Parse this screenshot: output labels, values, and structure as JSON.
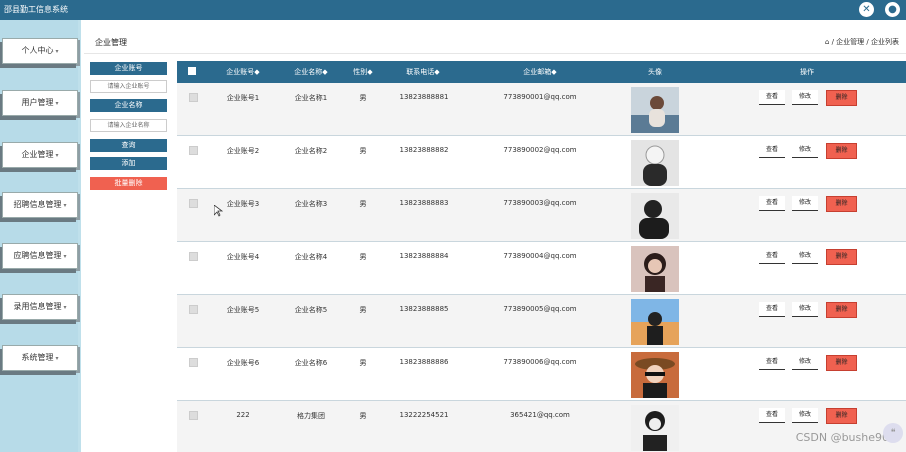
{
  "app": {
    "title": "邵县勤工信息系统"
  },
  "sidebar": {
    "items": [
      {
        "label": "个人中心"
      },
      {
        "label": "用户管理"
      },
      {
        "label": "企业管理"
      },
      {
        "label": "招聘信息管理"
      },
      {
        "label": "应聘信息管理"
      },
      {
        "label": "录用信息管理"
      },
      {
        "label": "系统管理"
      }
    ]
  },
  "page": {
    "title": "企业管理",
    "breadcrumb": "/ 企业管理 / 企业列表"
  },
  "search": {
    "account_label": "企业账号",
    "account_placeholder": "请输入企业账号",
    "name_label": "企业名称",
    "name_placeholder": "请输入企业名称",
    "query_label": "查询",
    "add_label": "添加",
    "batch_delete_label": "批量删除"
  },
  "table": {
    "headers": {
      "account": "企业账号◆",
      "name": "企业名称◆",
      "gender": "性别◆",
      "phone": "联系电话◆",
      "email": "企业邮箱◆",
      "avatar": "头像",
      "actions": "操作"
    },
    "view_label": "查看",
    "edit_label": "修改",
    "delete_label": "删除",
    "rows": [
      {
        "account": "企业账号1",
        "name": "企业名称1",
        "gender": "男",
        "phone": "13823888881",
        "email": "773890001@qq.com"
      },
      {
        "account": "企业账号2",
        "name": "企业名称2",
        "gender": "男",
        "phone": "13823888882",
        "email": "773890002@qq.com"
      },
      {
        "account": "企业账号3",
        "name": "企业名称3",
        "gender": "男",
        "phone": "13823888883",
        "email": "773890003@qq.com"
      },
      {
        "account": "企业账号4",
        "name": "企业名称4",
        "gender": "男",
        "phone": "13823888884",
        "email": "773890004@qq.com"
      },
      {
        "account": "企业账号5",
        "name": "企业名称5",
        "gender": "男",
        "phone": "13823888885",
        "email": "773890005@qq.com"
      },
      {
        "account": "企业账号6",
        "name": "企业名称6",
        "gender": "男",
        "phone": "13823888886",
        "email": "773890006@qq.com"
      },
      {
        "account": "222",
        "name": "格力集团",
        "gender": "男",
        "phone": "13222254521",
        "email": "365421@qq.com"
      }
    ]
  },
  "watermark": "CSDN @bushe902",
  "colors": {
    "primary": "#2b6a8e",
    "danger": "#f06150",
    "sidebar": "#b7dbe8"
  }
}
